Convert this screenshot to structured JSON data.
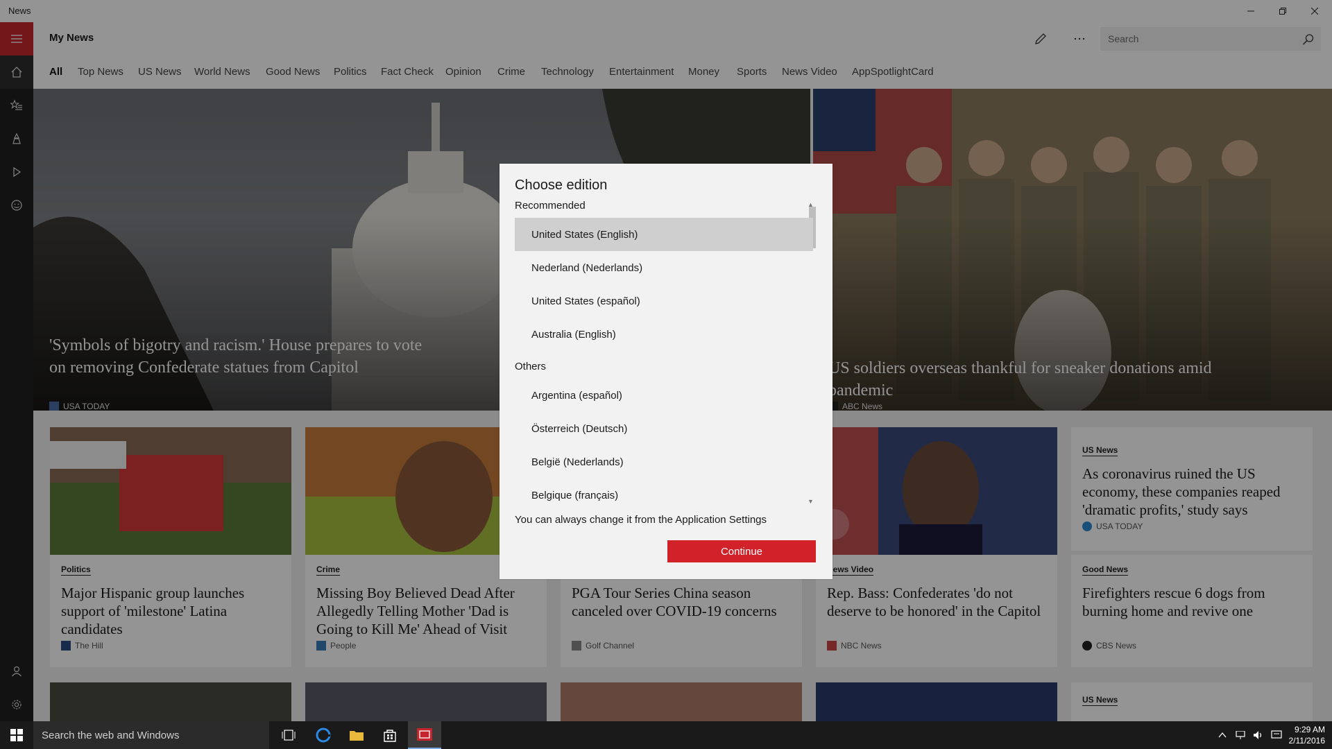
{
  "window": {
    "app_title": "News"
  },
  "header": {
    "page_title": "My News",
    "search_placeholder": "Search"
  },
  "tabs": [
    "All",
    "Top News",
    "US News",
    "World News",
    "Good News",
    "Politics",
    "Fact Check",
    "Opinion",
    "Crime",
    "Technology",
    "Entertainment",
    "Money",
    "Sports",
    "News Video",
    "AppSpotlightCard"
  ],
  "hero": [
    {
      "headline": "'Symbols of bigotry and racism.' House prepares to vote on removing Confederate statues from Capitol",
      "source": "USA TODAY"
    },
    {
      "headline": "US soldiers overseas thankful for sneaker donations amid pandemic",
      "source": "ABC News"
    }
  ],
  "cards": [
    {
      "category": "Politics",
      "title": "Major Hispanic group launches support of 'milestone' Latina candidates",
      "source": "The Hill"
    },
    {
      "category": "Crime",
      "title": "Missing Boy Believed Dead After Allegedly Telling Mother 'Dad is Going to Kill Me' Ahead of Visit",
      "source": "People"
    },
    {
      "category": "",
      "title": "PGA Tour Series China season canceled over COVID-19 concerns",
      "source": "Golf Channel"
    },
    {
      "category": "News Video",
      "title": "Rep. Bass: Confederates 'do not deserve to be honored' in the Capitol",
      "source": "NBC News"
    }
  ],
  "side_cards": [
    {
      "category": "US News",
      "title": "As coronavirus ruined the US economy, these companies reaped 'dramatic profits,' study says",
      "source": "USA TODAY"
    },
    {
      "category": "Good News",
      "title": "Firefighters rescue 6 dogs from burning home and revive one",
      "source": "CBS News"
    },
    {
      "category": "US News"
    }
  ],
  "dialog": {
    "title": "Choose edition",
    "recommended_label": "Recommended",
    "recommended": [
      "United States (English)",
      "Nederland (Nederlands)",
      "United States (español)",
      "Australia (English)"
    ],
    "others_label": "Others",
    "others": [
      "Argentina (español)",
      "Österreich (Deutsch)",
      "België (Nederlands)",
      "Belgique (français)"
    ],
    "note": "You can always change it from the Application Settings",
    "continue_label": "Continue"
  },
  "taskbar": {
    "search_placeholder": "Search the web and Windows",
    "time": "9:29 AM",
    "date": "2/11/2016"
  },
  "colors": {
    "accent": "#c4262e",
    "continue_button": "#d1222a",
    "rail": "#1f1f1f"
  }
}
